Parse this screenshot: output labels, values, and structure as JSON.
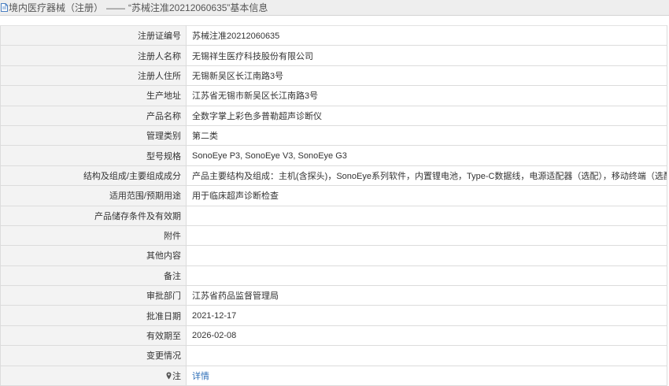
{
  "header": {
    "icon": "document-icon",
    "category": "境内医疗器械（注册）",
    "separator": "——",
    "record_title": "“苏械注准20212060635”",
    "suffix": "基本信息"
  },
  "rows": [
    {
      "label": "注册证编号",
      "value": "苏械注准20212060635"
    },
    {
      "label": "注册人名称",
      "value": "无锡祥生医疗科技股份有限公司"
    },
    {
      "label": "注册人住所",
      "value": "无锡新吴区长江南路3号"
    },
    {
      "label": "生产地址",
      "value": "江苏省无锡市新吴区长江南路3号"
    },
    {
      "label": "产品名称",
      "value": "全数字掌上彩色多普勒超声诊断仪"
    },
    {
      "label": "管理类别",
      "value": "第二类"
    },
    {
      "label": "型号规格",
      "value": "SonoEye P3, SonoEye V3, SonoEye G3"
    },
    {
      "label": "结构及组成/主要组成成分",
      "value": "产品主要结构及组成：主机(含探头)，SonoEye系列软件，内置锂电池，Type-C数据线，电源适配器（选配），移动终端（选配）。"
    },
    {
      "label": "适用范围/预期用途",
      "value": "用于临床超声诊断检查"
    },
    {
      "label": "产品储存条件及有效期",
      "value": ""
    },
    {
      "label": "附件",
      "value": ""
    },
    {
      "label": "其他内容",
      "value": ""
    },
    {
      "label": "备注",
      "value": ""
    },
    {
      "label": "审批部门",
      "value": "江苏省药品监督管理局"
    },
    {
      "label": "批准日期",
      "value": "2021-12-17"
    },
    {
      "label": "有效期至",
      "value": "2026-02-08"
    },
    {
      "label": "变更情况",
      "value": ""
    }
  ],
  "note_row": {
    "label": "注",
    "icon": "map-pin-icon",
    "link_text": "详情",
    "link_color": "#2f6fb8"
  }
}
